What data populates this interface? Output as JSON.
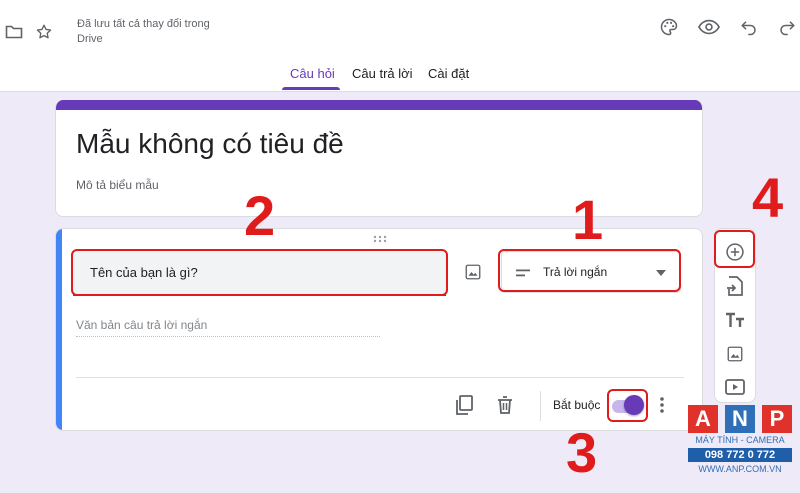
{
  "header": {
    "saved_status": "Đã lưu tất cả thay đổi trong Drive",
    "tabs": [
      {
        "label": "Câu hỏi",
        "active": true
      },
      {
        "label": "Câu trả lời",
        "active": false
      },
      {
        "label": "Cài đặt",
        "active": false
      }
    ],
    "icons": [
      "folder-icon",
      "star-icon",
      "palette-icon",
      "eye-icon",
      "undo-icon",
      "redo-icon"
    ]
  },
  "form": {
    "title": "Mẫu không có tiêu đề",
    "description": "Mô tả biểu mẫu",
    "accent_color": "#673ab7"
  },
  "question": {
    "text": "Tên của bạn là gì?",
    "type": "Trả lời ngắn",
    "answer_placeholder": "Văn bản câu trả lời ngắn",
    "required_label": "Bắt buộc",
    "required": true
  },
  "toolbar": {
    "items": [
      "add-question-icon",
      "import-questions-icon",
      "add-title-icon",
      "add-image-icon",
      "add-video-icon"
    ]
  },
  "annotations": {
    "n1": "1",
    "n2": "2",
    "n3": "3",
    "n4": "4",
    "color": "#e01b1b"
  },
  "watermark": {
    "letters": [
      "A",
      "N",
      "P"
    ],
    "line1": "MÁY TÍNH - CAMERA",
    "phone": "098 772 0 772",
    "site": "WWW.ANP.COM.VN"
  }
}
